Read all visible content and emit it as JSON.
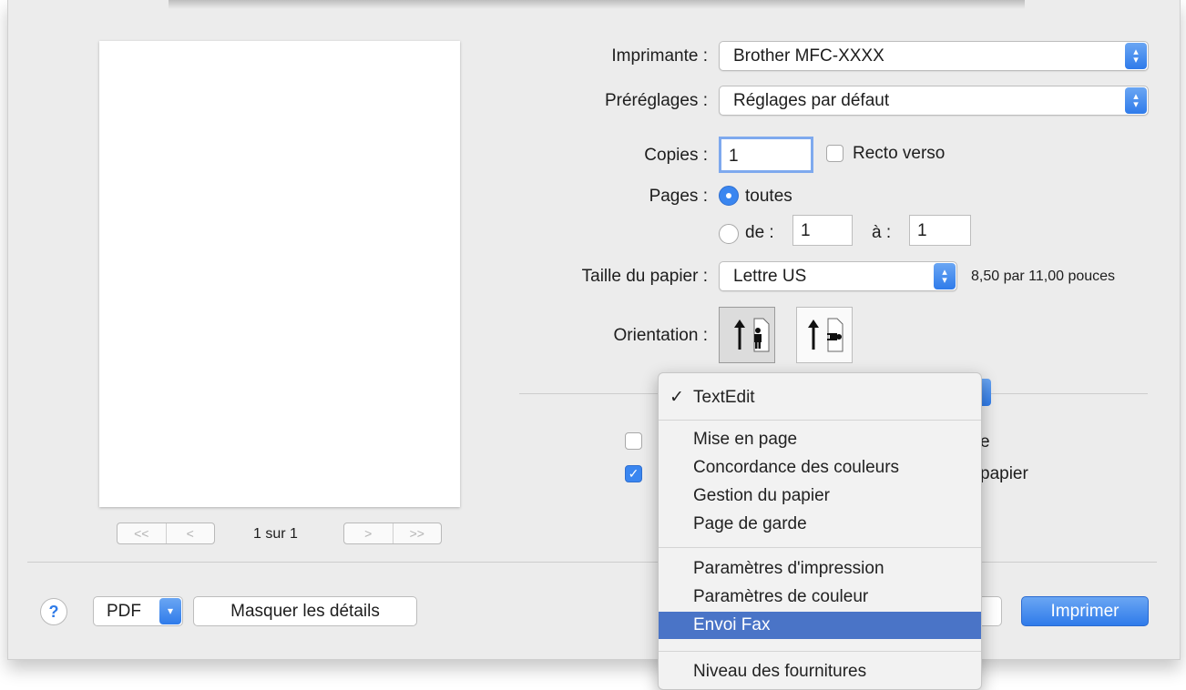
{
  "printer": {
    "label": "Imprimante :",
    "value": "Brother MFC-XXXX"
  },
  "presets": {
    "label": "Préréglages :",
    "value": "Réglages par défaut"
  },
  "copies": {
    "label": "Copies :",
    "value": "1",
    "duplex_label": "Recto verso"
  },
  "pages": {
    "label": "Pages :",
    "all_label": "toutes",
    "from_label": "de :",
    "from_value": "1",
    "to_label": "à :",
    "to_value": "1"
  },
  "paper": {
    "label": "Taille du papier :",
    "value": "Lettre US",
    "dimensions": "8,50 par 11,00 pouces"
  },
  "orientation": {
    "label": "Orientation :"
  },
  "preview": {
    "page_indicator": "1 sur 1",
    "first": "<<",
    "prev": "<",
    "next": ">",
    "last": ">>"
  },
  "options": {
    "partial_right_1": "e",
    "partial_right_2": "papier"
  },
  "bottom": {
    "help": "?",
    "pdf": "PDF",
    "hide_details": "Masquer les détails",
    "print": "Imprimer"
  },
  "menu": {
    "checked_item": "TextEdit",
    "group1": [
      "Mise en page",
      "Concordance des couleurs",
      "Gestion du papier",
      "Page de garde"
    ],
    "group2": [
      "Paramètres d'impression",
      "Paramètres de couleur"
    ],
    "selected": "Envoi Fax",
    "group3": [
      "Niveau des fournitures"
    ]
  },
  "colors": {
    "accent": "#3a86f0",
    "menu_highlight": "#4a74c7"
  }
}
